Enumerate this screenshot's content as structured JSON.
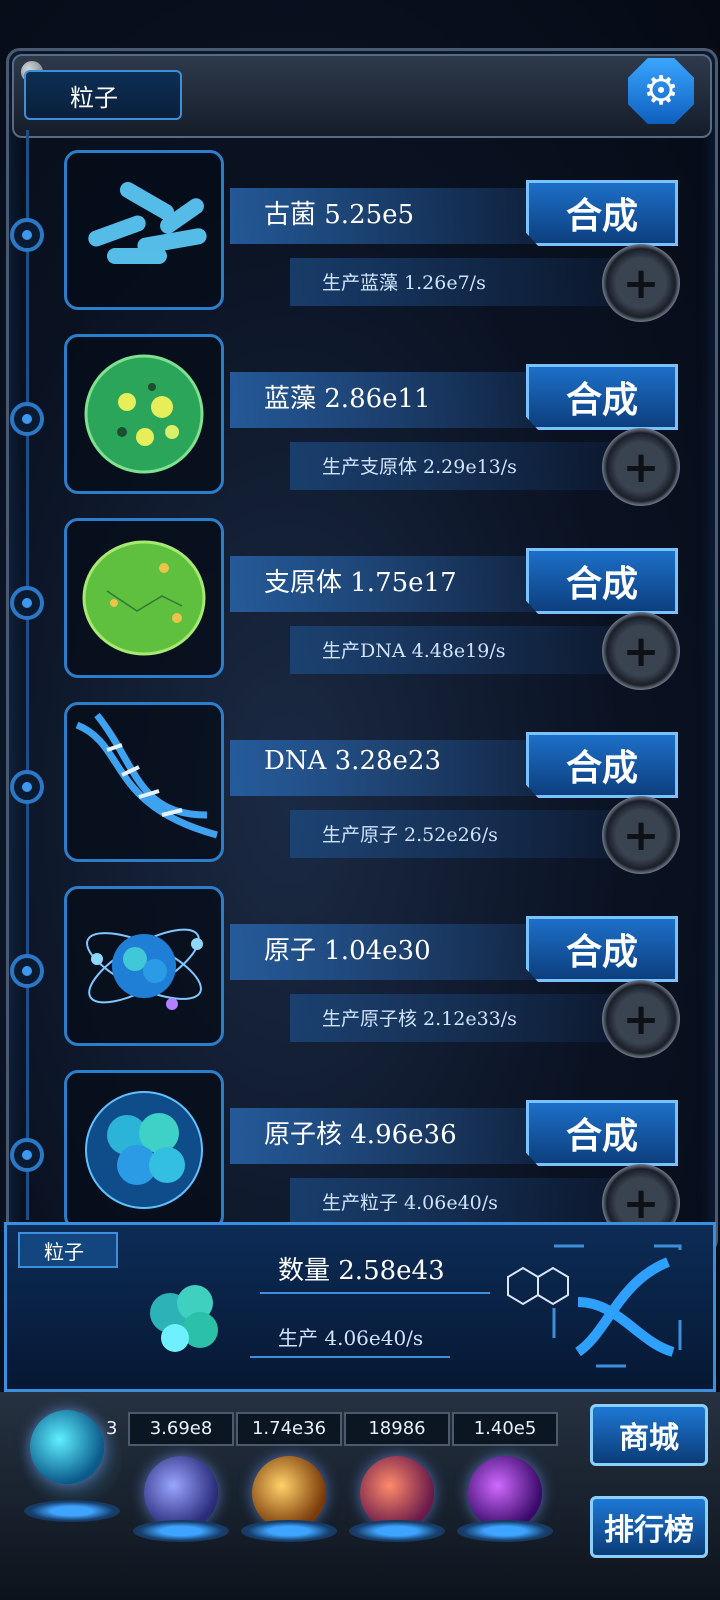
{
  "header": {
    "title": "粒子",
    "settings_icon": "gear-icon"
  },
  "rows": [
    {
      "name_label": "古菌 5.25e5",
      "production": "生产蓝藻 1.26e7/s",
      "button": "合成",
      "icon": "archaea-icon"
    },
    {
      "name_label": "蓝藻 2.86e11",
      "production": "生产支原体 2.29e13/s",
      "button": "合成",
      "icon": "cyanobacteria-icon"
    },
    {
      "name_label": "支原体 1.75e17",
      "production": "生产DNA 4.48e19/s",
      "button": "合成",
      "icon": "mycoplasma-icon"
    },
    {
      "name_label": "DNA 3.28e23",
      "production": "生产原子 2.52e26/s",
      "button": "合成",
      "icon": "dna-icon"
    },
    {
      "name_label": "原子 1.04e30",
      "production": "生产原子核 2.12e33/s",
      "button": "合成",
      "icon": "atom-icon"
    },
    {
      "name_label": "原子核 4.96e36",
      "production": "生产粒子 4.06e40/s",
      "button": "合成",
      "icon": "nucleus-icon"
    }
  ],
  "panel": {
    "tag": "粒子",
    "count": "数量 2.58e43",
    "rate": "生产 4.06e40/s"
  },
  "dock": {
    "stats": [
      "3.69e8",
      "1.74e36",
      "18986",
      "1.40e5"
    ],
    "partial_stat": "3",
    "shop_label": "商城",
    "rank_label": "排行榜"
  },
  "colors": {
    "accent": "#2d7ec8",
    "button": "#1d6fc8",
    "background": "#0a1222"
  }
}
